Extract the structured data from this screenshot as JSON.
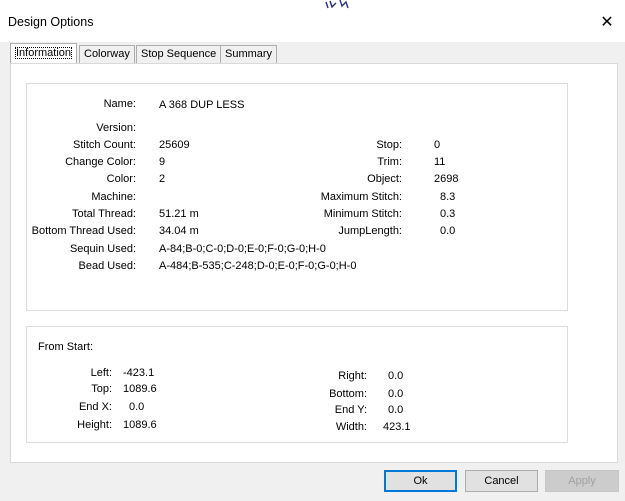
{
  "window": {
    "title": "Design Options",
    "close_glyph": "✕"
  },
  "tabs": [
    {
      "label": "Information"
    },
    {
      "label": "Colorway"
    },
    {
      "label": "Stop Sequence"
    },
    {
      "label": "Summary"
    }
  ],
  "info": {
    "name": {
      "label": "Name:",
      "value": "A 368 DUP LESS"
    },
    "version": {
      "label": "Version:",
      "value": ""
    },
    "stitch_count": {
      "label": "Stitch Count:",
      "value": "25609"
    },
    "change_color": {
      "label": "Change Color:",
      "value": "9"
    },
    "color": {
      "label": "Color:",
      "value": "2"
    },
    "machine": {
      "label": "Machine:",
      "value": ""
    },
    "total_thread": {
      "label": "Total Thread:",
      "value": "51.21 m"
    },
    "bottom_thread": {
      "label": "Bottom Thread Used:",
      "value": "34.04 m"
    },
    "sequin": {
      "label": "Sequin Used:",
      "value": "A-84;B-0;C-0;D-0;E-0;F-0;G-0;H-0"
    },
    "bead": {
      "label": "Bead Used:",
      "value": "A-484;B-535;C-248;D-0;E-0;F-0;G-0;H-0"
    },
    "stop": {
      "label": "Stop:",
      "value": "0"
    },
    "trim": {
      "label": "Trim:",
      "value": "11"
    },
    "object": {
      "label": "Object:",
      "value": "2698"
    },
    "max_stitch": {
      "label": "Maximum Stitch:",
      "value": "8.3"
    },
    "min_stitch": {
      "label": "Minimum Stitch:",
      "value": "0.3"
    },
    "jump_length": {
      "label": "JumpLength:",
      "value": "0.0"
    }
  },
  "from_start": {
    "title": "From Start:",
    "left": {
      "label": "Left:",
      "value": "-423.1"
    },
    "top": {
      "label": "Top:",
      "value": "1089.6"
    },
    "end_x": {
      "label": "End X:",
      "value": "0.0"
    },
    "height": {
      "label": "Height:",
      "value": "1089.6"
    },
    "right": {
      "label": "Right:",
      "value": "0.0"
    },
    "bottom": {
      "label": "Bottom:",
      "value": "0.0"
    },
    "end_y": {
      "label": "End Y:",
      "value": "0.0"
    },
    "width": {
      "label": "Width:",
      "value": "423.1"
    }
  },
  "buttons": {
    "ok": "Ok",
    "cancel": "Cancel",
    "apply": "Apply"
  }
}
